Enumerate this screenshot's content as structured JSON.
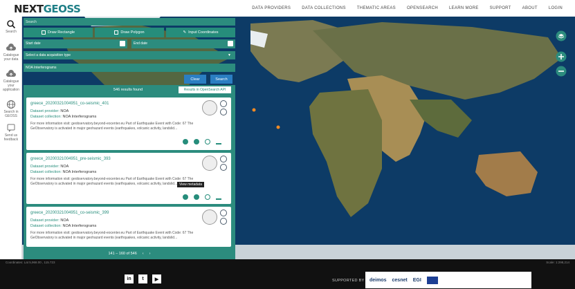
{
  "brand": {
    "logo_prefix": "NEXT",
    "logo_suffix": "GEOSS"
  },
  "nav": [
    "DATA PROVIDERS",
    "DATA COLLECTIONS",
    "THEMATIC AREAS",
    "OPENSEARCH",
    "LEARN MORE",
    "SUPPORT",
    "ABOUT",
    "LOGIN"
  ],
  "rail": [
    {
      "label": "Search",
      "icon": "search-icon"
    },
    {
      "label": "Catalogue your data",
      "icon": "cloud-upload-icon"
    },
    {
      "label": "Catalogue your application",
      "icon": "cloud-upload-icon"
    },
    {
      "label": "Search in GEOSS",
      "icon": "globe-icon"
    },
    {
      "label": "Send us feedback",
      "icon": "feedback-icon"
    }
  ],
  "search": {
    "placeholder": "Search"
  },
  "draw": {
    "rectangle": "Draw Rectangle",
    "polygon": "Draw Polygon",
    "coordinates": "Input Coordinates"
  },
  "dates": {
    "start_placeholder": "Start date",
    "end_placeholder": "End date"
  },
  "acquisition": {
    "placeholder": "Select a data acquisition type"
  },
  "collection": {
    "value": "NOA Interferograms"
  },
  "actions": {
    "clear": "Clear",
    "search": "Search"
  },
  "results": {
    "found": "546 results found",
    "opensearch_btn": "Results in OpenSearch API",
    "items": [
      {
        "title": "greece_20200321004951_co-seismic_401",
        "provider_label": "Dataset provider:",
        "provider": "NOA",
        "collection_label": "Dataset collection:",
        "collection": "NOA Interferograms",
        "description": "For more information visit: geobservatory.beyond-eocenter.eu Part of Earthquake Event with Code: 67 The GeObservatory is activated in major geohazard events (earthquakes, volcanic activity, landslid..."
      },
      {
        "title": "greece_20200321004951_pre-seismic_393",
        "provider_label": "Dataset provider:",
        "provider": "NOA",
        "collection_label": "Dataset collection:",
        "collection": "NOA Interferograms",
        "description": "For more information visit: geobservatory.beyond-eocenter.eu Part of Earthquake Event with Code: 67 The GeObservatory is activated in major geohazard events (earthquakes, volcanic activity, landslid..."
      },
      {
        "title": "greece_20200321004951_co-seismic_399",
        "provider_label": "Dataset provider:",
        "provider": "NOA",
        "collection_label": "Dataset collection:",
        "collection": "NOA Interferograms",
        "description": "For more information visit: geobservatory.beyond-eocenter.eu Part of Earthquake Event with Code: 67 The GeObservatory is activated in major geohazard events (earthquakes, volcanic activity, landslid..."
      }
    ],
    "tooltip": "View metadata",
    "pager": "141 – 160 of 546"
  },
  "footer": {
    "coordinates": "Coordinates: Lat 5,968.00 , 115.723",
    "scale": "Scale: 1:298,214",
    "supported": "SUPPORTED BY",
    "partners": [
      "deimos",
      "cesnet",
      "EGI"
    ],
    "social": [
      "linkedin-icon",
      "twitter-icon",
      "youtube-icon"
    ]
  },
  "colors": {
    "teal": "#2c8c7e",
    "blue_button": "#2b7ec2",
    "ocean": "#0b3a63"
  }
}
